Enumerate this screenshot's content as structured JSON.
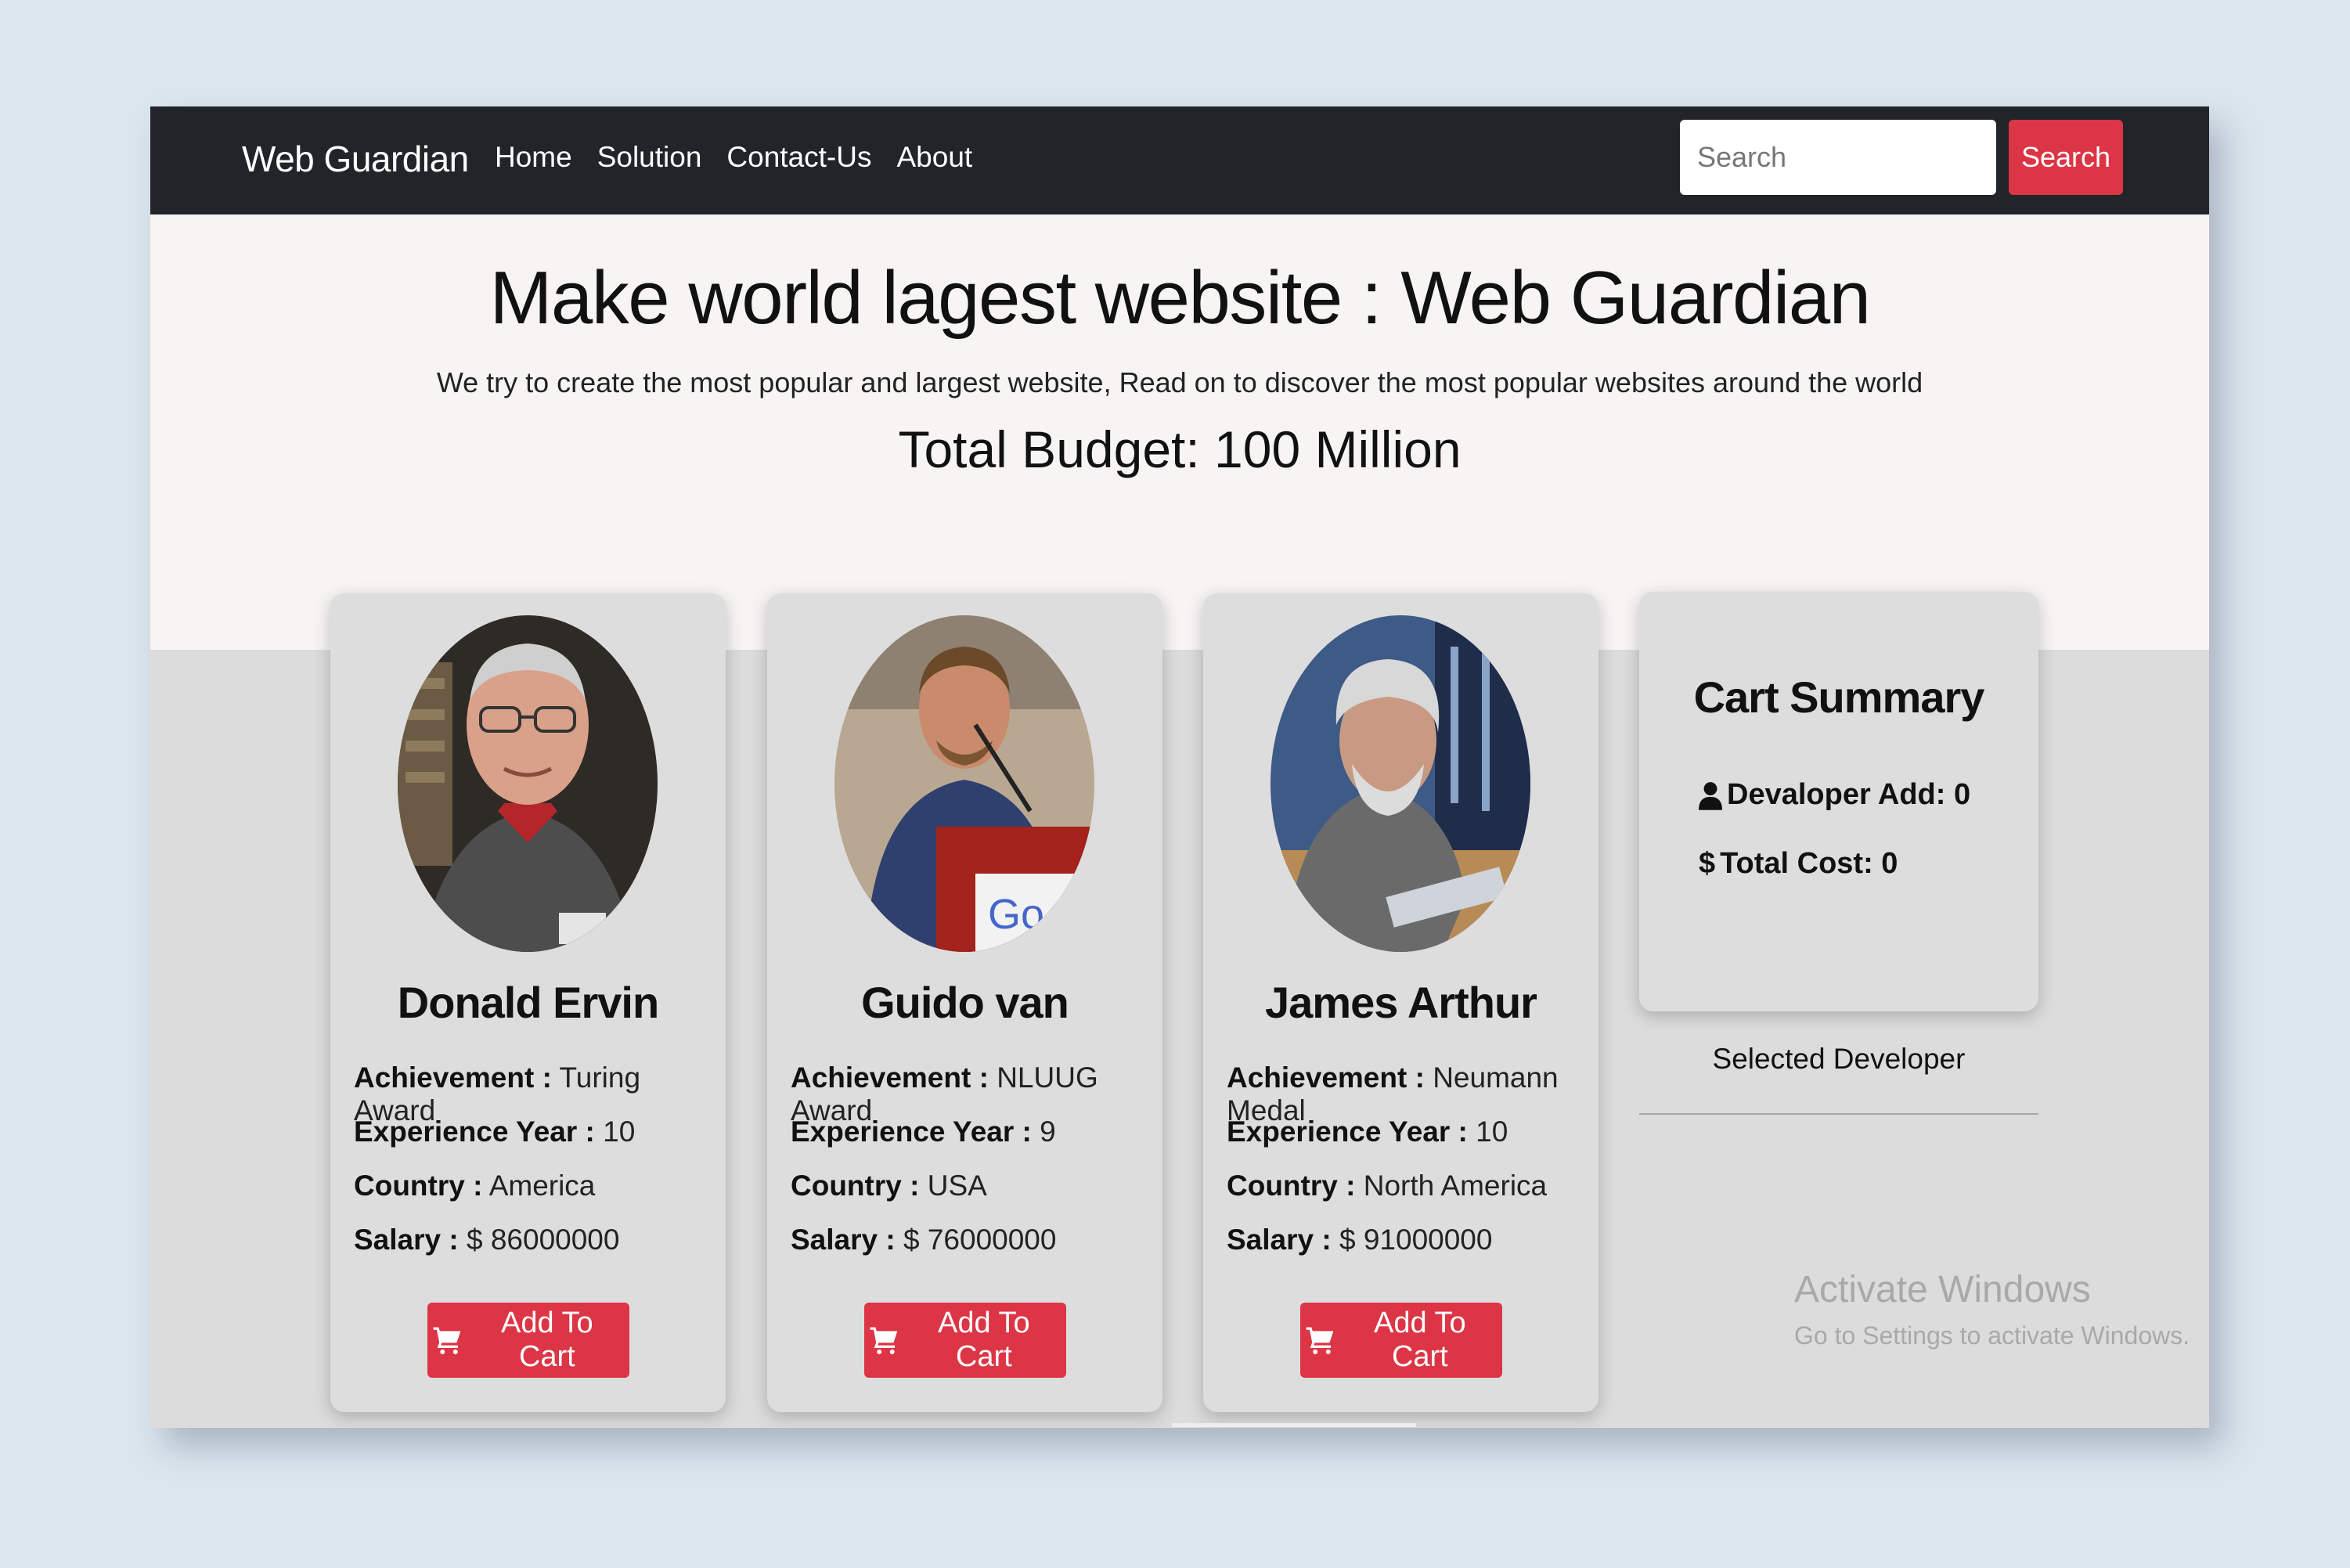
{
  "navbar": {
    "brand": "Web Guardian",
    "links": [
      "Home",
      "Solution",
      "Contact-Us",
      "About"
    ],
    "search_placeholder": "Search",
    "search_button": "Search"
  },
  "hero": {
    "title": "Make world lagest website : Web Guardian",
    "subtitle": "We try to create the most popular and largest website, Read on to discover the most popular websites around the world",
    "budget": "Total Budget: 100 Million"
  },
  "labels": {
    "achievement": "Achievement :",
    "experience": "Experience Year :",
    "country": "Country :",
    "salary": "Salary :",
    "add_to_cart": "Add To Cart"
  },
  "developers": [
    {
      "name": "Donald Ervin",
      "achievement": "Turing Award",
      "experience": "10",
      "country": "America",
      "salary": "$ 86000000"
    },
    {
      "name": "Guido van",
      "achievement": "NLUUG Award",
      "experience": "9",
      "country": "USA",
      "salary": "$ 76000000"
    },
    {
      "name": "James Arthur",
      "achievement": "Neumann Medal",
      "experience": "10",
      "country": "North America",
      "salary": "$ 91000000"
    }
  ],
  "cart": {
    "title": "Cart Summary",
    "developer_add": "Devaloper Add: 0",
    "total_cost": "Total Cost: 0",
    "selected_label": "Selected Developer"
  },
  "watermark": {
    "line1": "Activate Windows",
    "line2": "Go to Settings to activate Windows."
  },
  "icons": {
    "cart": "shopping-cart-icon",
    "user": "user-icon",
    "dollar": "dollar-icon"
  },
  "colors": {
    "navbar": "#212529",
    "accent": "#dc3545",
    "hero_bg": "#f7f5f4",
    "card_bg": "#dddddd",
    "page_bg": "#dce6ef"
  }
}
